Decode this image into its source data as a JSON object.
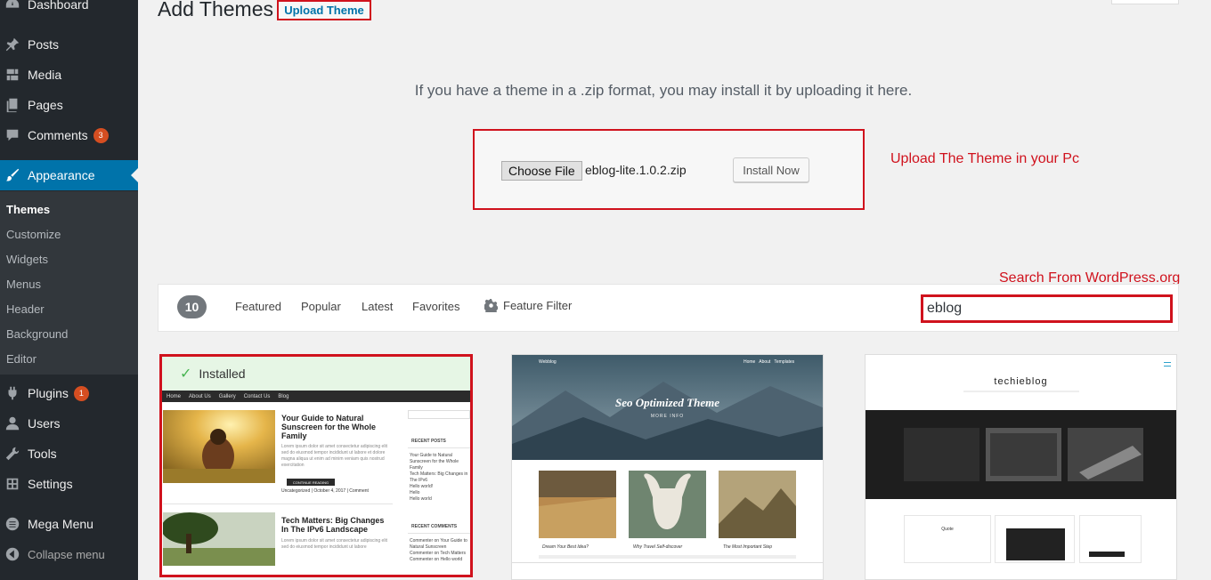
{
  "sidebar": {
    "items": [
      {
        "label": "Dashboard",
        "icon": "dashboard-icon"
      },
      {
        "label": "Posts",
        "icon": "pin-icon"
      },
      {
        "label": "Media",
        "icon": "media-icon"
      },
      {
        "label": "Pages",
        "icon": "pages-icon"
      },
      {
        "label": "Comments",
        "icon": "comment-icon",
        "badge": "3"
      },
      {
        "label": "Appearance",
        "icon": "brush-icon",
        "current": true
      },
      {
        "label": "Plugins",
        "icon": "plug-icon",
        "badge": "1"
      },
      {
        "label": "Users",
        "icon": "user-icon"
      },
      {
        "label": "Tools",
        "icon": "wrench-icon"
      },
      {
        "label": "Settings",
        "icon": "settings-icon"
      },
      {
        "label": "Mega Menu",
        "icon": "menu-circle-icon"
      },
      {
        "label": "Collapse menu",
        "icon": "collapse-icon"
      }
    ],
    "submenu": [
      "Themes",
      "Customize",
      "Widgets",
      "Menus",
      "Header",
      "Background",
      "Editor"
    ]
  },
  "header": {
    "title": "Add Themes",
    "upload_button": "Upload Theme"
  },
  "upload": {
    "help_text": "If you have a theme in a .zip format, you may install it by uploading it here.",
    "choose_file_label": "Choose File",
    "file_name": "eblog-lite.1.0.2.zip",
    "install_label": "Install Now"
  },
  "annotations": {
    "upload_note": "Upload The Theme in your Pc",
    "search_note": "Search From WordPress.org"
  },
  "filter": {
    "count": "10",
    "tabs": [
      "Featured",
      "Popular",
      "Latest",
      "Favorites"
    ],
    "feature_filter": "Feature Filter",
    "search_value": "eblog"
  },
  "themes": [
    {
      "installed_label": "Installed",
      "preview": {
        "nav": [
          "Home",
          "About Us",
          "Gallery",
          "Contact Us",
          "Blog"
        ],
        "post1_title": "Your Guide to Natural Sunscreen for the Whole Family",
        "post1_button": "CONTINUE READING",
        "post1_meta": "Uncategorized | October 4, 2017 | Comment",
        "post2_title": "Tech Matters: Big Changes In The IPv6 Landscape",
        "side_recent_posts": "RECENT POSTS",
        "side_recent_comments": "RECENT COMMENTS"
      }
    },
    {
      "preview": {
        "hero_title": "Seo Optimized Theme",
        "hero_sub": "MORE INFO",
        "captions": [
          "Dream Your Best Idea?",
          "Why Travel Self-discover",
          "The Most Important Step"
        ]
      }
    },
    {
      "preview": {
        "logo": "techieblog"
      }
    }
  ],
  "colors": {
    "sidebar_bg": "#23282d",
    "accent": "#0073aa",
    "highlight_red": "#d0121d",
    "badge": "#d54e21",
    "installed_bg": "#e6f6e5"
  }
}
